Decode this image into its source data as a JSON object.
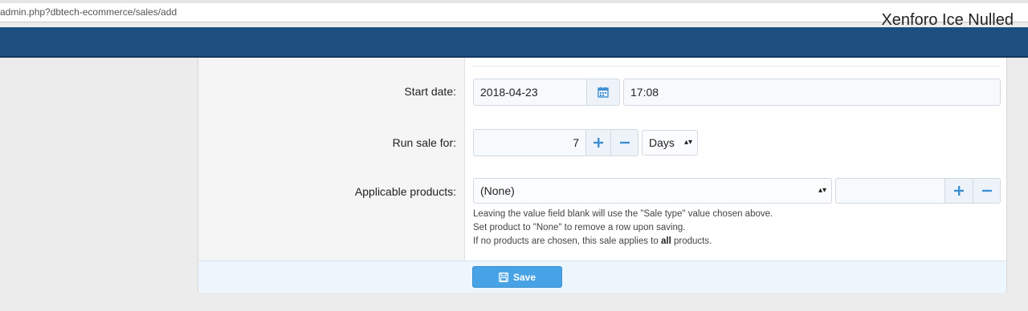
{
  "browser": {
    "url": "admin.php?dbtech-ecommerce/sales/add"
  },
  "watermark": "Xenforo Ice Nulled",
  "form": {
    "start_date": {
      "label": "Start date:",
      "date_value": "2018-04-23",
      "time_value": "17:08"
    },
    "run_sale": {
      "label": "Run sale for:",
      "amount": "7",
      "unit": "Days"
    },
    "products": {
      "label": "Applicable products:",
      "selected": "(None)",
      "value": "",
      "explain": [
        "Leaving the value field blank will use the \"Sale type\" value chosen above.",
        "Set product to \"None\" to remove a row upon saving."
      ],
      "explain3_before": "If no products are chosen, this sale applies to ",
      "explain3_bold": "all",
      "explain3_after": " products."
    }
  },
  "footer": {
    "save_label": "Save"
  },
  "colors": {
    "header": "#1d5080",
    "accent": "#47a3e6",
    "icon": "#3d8fd4"
  }
}
